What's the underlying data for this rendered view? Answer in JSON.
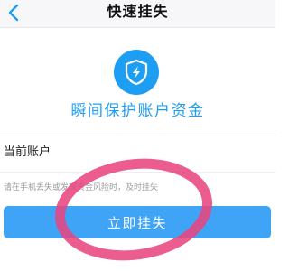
{
  "header": {
    "title": "快速挂失",
    "back_icon": "chevron-left-icon"
  },
  "hero": {
    "icon": "shield-lightning-icon",
    "slogan": "瞬间保护账户资金"
  },
  "account": {
    "label": "当前账户"
  },
  "tip": {
    "text": "请在手机丢失或发现资金风险时，及时挂失"
  },
  "actions": {
    "report_label": "立即挂失"
  },
  "colors": {
    "accent": "#1e9ef2",
    "button": "#3fa3f6",
    "annotation_ring": "#e8467f"
  }
}
